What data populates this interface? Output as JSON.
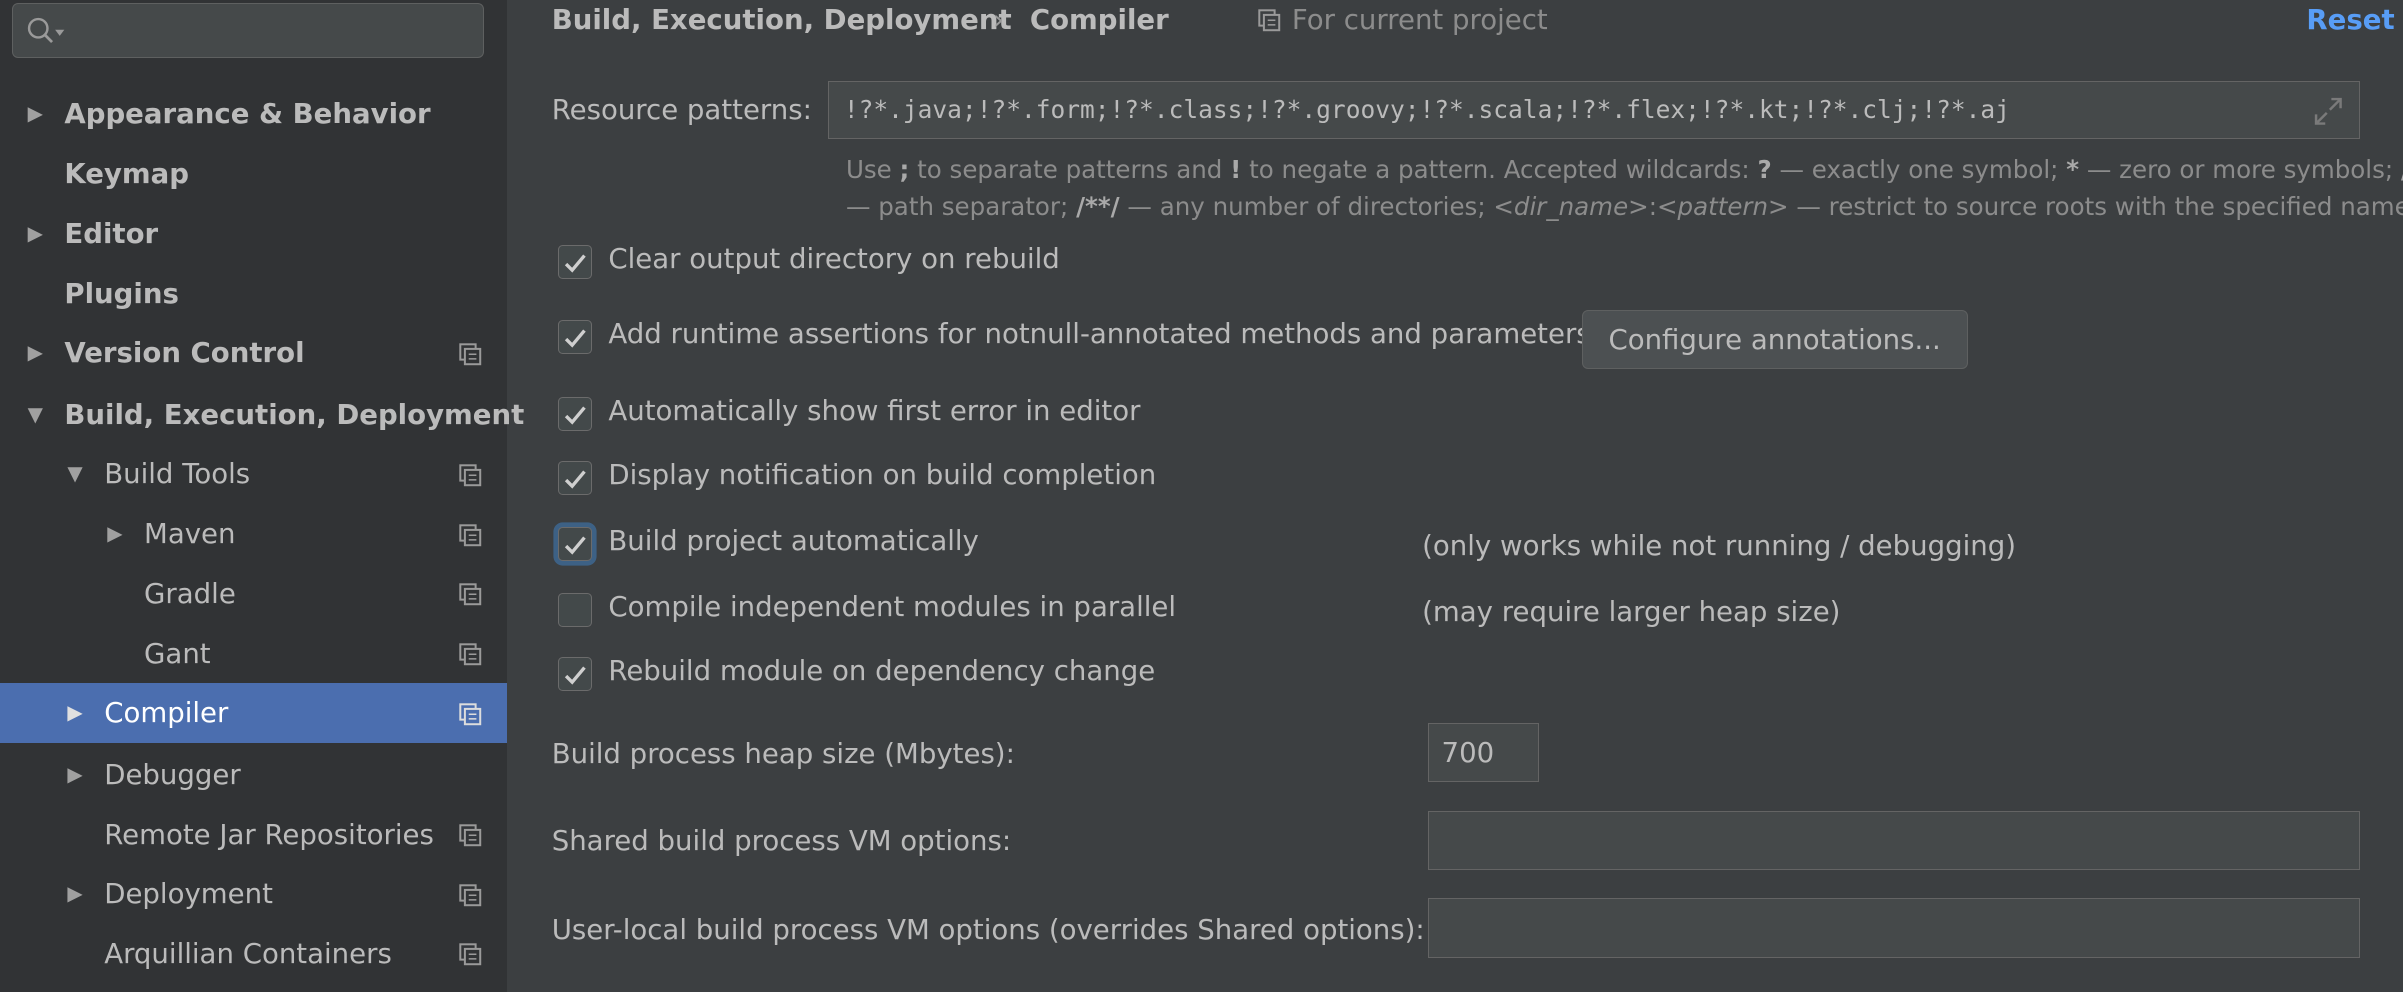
{
  "search": {
    "placeholder": ""
  },
  "sidebar": {
    "items": [
      {
        "label": "Appearance & Behavior",
        "arrow": "▶",
        "bold": true,
        "project_icon": false,
        "selected": false
      },
      {
        "label": "Keymap",
        "arrow": "",
        "bold": true,
        "project_icon": false,
        "selected": false
      },
      {
        "label": "Editor",
        "arrow": "▶",
        "bold": true,
        "project_icon": false,
        "selected": false
      },
      {
        "label": "Plugins",
        "arrow": "",
        "bold": true,
        "project_icon": false,
        "selected": false
      },
      {
        "label": "Version Control",
        "arrow": "▶",
        "bold": true,
        "project_icon": true,
        "selected": false
      },
      {
        "label": "Build, Execution, Deployment",
        "arrow": "▼",
        "bold": true,
        "project_icon": false,
        "selected": false
      },
      {
        "label": "Build Tools",
        "arrow": "▼",
        "bold": false,
        "project_icon": true,
        "selected": false
      },
      {
        "label": "Maven",
        "arrow": "▶",
        "bold": false,
        "project_icon": true,
        "selected": false
      },
      {
        "label": "Gradle",
        "arrow": "",
        "bold": false,
        "project_icon": true,
        "selected": false
      },
      {
        "label": "Gant",
        "arrow": "",
        "bold": false,
        "project_icon": true,
        "selected": false
      },
      {
        "label": "Compiler",
        "arrow": "▶",
        "bold": false,
        "project_icon": true,
        "selected": true
      },
      {
        "label": "Debugger",
        "arrow": "▶",
        "bold": false,
        "project_icon": false,
        "selected": false
      },
      {
        "label": "Remote Jar Repositories",
        "arrow": "",
        "bold": false,
        "project_icon": true,
        "selected": false
      },
      {
        "label": "Deployment",
        "arrow": "▶",
        "bold": false,
        "project_icon": true,
        "selected": false
      },
      {
        "label": "Arquillian Containers",
        "arrow": "",
        "bold": false,
        "project_icon": true,
        "selected": false
      }
    ]
  },
  "header": {
    "breadcrumb_parent": "Build, Execution, Deployment",
    "separator": "›",
    "breadcrumb_current": "Compiler",
    "scope": "For current project",
    "reset": "Reset"
  },
  "resource": {
    "label": "Resource patterns:",
    "value": "!?*.java;!?*.form;!?*.class;!?*.groovy;!?*.scala;!?*.flex;!?*.kt;!?*.clj;!?*.aj"
  },
  "hint": {
    "t1": "Use ",
    "k1": ";",
    "t2": " to separate patterns and ",
    "k2": "!",
    "t3": " to negate a pattern. Accepted wildcards: ",
    "k3": "?",
    "t4": " — exactly one symbol; ",
    "k4": "*",
    "t5": " — zero or more symbols; ",
    "k5": "/",
    "t6": "— path separator; ",
    "k6": "/**/",
    "t7": " — any number of directories; ",
    "i1": "<dir_name>",
    "t8": ":",
    "i2": "<pattern>",
    "t9": " — restrict to source roots with the specified name"
  },
  "options": [
    {
      "label": "Clear output directory on rebuild",
      "checked": true,
      "note": ""
    },
    {
      "label": "Add runtime assertions for notnull-annotated methods and parameters",
      "checked": true,
      "note": ""
    },
    {
      "label": "Automatically show first error in editor",
      "checked": true,
      "note": ""
    },
    {
      "label": "Display notification on build completion",
      "checked": true,
      "note": ""
    },
    {
      "label": "Build project automatically",
      "checked": true,
      "note": "(only works while not running / debugging)"
    },
    {
      "label": "Compile independent modules in parallel",
      "checked": false,
      "note": "(may require larger heap size)"
    },
    {
      "label": "Rebuild module on dependency change",
      "checked": true,
      "note": ""
    }
  ],
  "configure_button": "Configure annotations...",
  "heap": {
    "label": "Build process heap size (Mbytes):",
    "value": "700"
  },
  "shared_vm": {
    "label": "Shared build process VM options:",
    "value": ""
  },
  "user_vm": {
    "label": "User-local build process VM options (overrides Shared options):",
    "value": ""
  },
  "icons": {
    "search": "search-icon",
    "project_scope": "project-scope-icon",
    "expand": "expand-icon",
    "check": "checkmark-icon"
  },
  "colors": {
    "background": "#3c3f41",
    "sidebar": "#313335",
    "selection": "#4b6eaf",
    "link": "#589df6",
    "text": "#bbbbbb",
    "focus": "#3d6185"
  }
}
